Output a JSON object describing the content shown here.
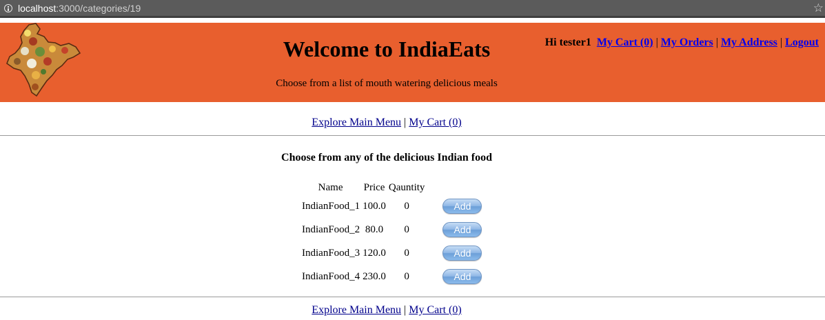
{
  "browser": {
    "url_host": "localhost",
    "url_rest": ":3000/categories/19"
  },
  "header": {
    "title": "Welcome to IndiaEats",
    "tagline": "Choose from a list of mouth watering delicious meals",
    "greeting": "Hi tester1",
    "links": {
      "cart": "My Cart (0)",
      "orders": "My Orders",
      "address": "My Address",
      "logout": "Logout"
    },
    "separator": "|",
    "colors": {
      "banner": "#e85f2e"
    }
  },
  "nav": {
    "main_menu": "Explore Main Menu",
    "cart": "My Cart (0)",
    "separator": "|"
  },
  "main": {
    "title": "Choose from any of the delicious Indian food",
    "columns": [
      "Name",
      "Price",
      "Qauntity"
    ],
    "rows": [
      {
        "name": "IndianFood_1",
        "price": "100.0",
        "quantity": "0",
        "action": "Add"
      },
      {
        "name": "IndianFood_2",
        "price": "80.0",
        "quantity": "0",
        "action": "Add"
      },
      {
        "name": "IndianFood_3",
        "price": "120.0",
        "quantity": "0",
        "action": "Add"
      },
      {
        "name": "IndianFood_4",
        "price": "230.0",
        "quantity": "0",
        "action": "Add"
      }
    ]
  },
  "icons": {
    "site_info": "info-icon",
    "bookmark": "star-icon",
    "logo": "india-map-logo"
  }
}
